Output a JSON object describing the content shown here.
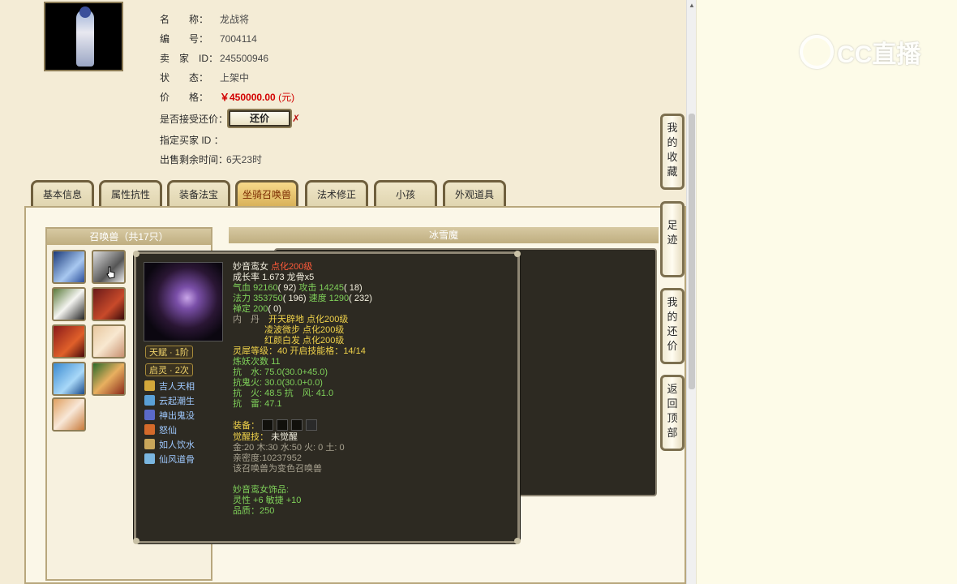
{
  "item": {
    "name_label": "名　　称：",
    "name": "龙战将",
    "id_label": "编　　号：",
    "id": "7004114",
    "seller_label": "卖　家　ID：",
    "seller_id": "245500946",
    "status_label": "状　　态：",
    "status": "上架中",
    "price_label": "价　　格：",
    "price": "￥450000.00",
    "price_unit": "(元)",
    "counter_label": "是否接受还价：",
    "counter_button": "还价",
    "counter_x": "✗",
    "buyer_label": "指定买家 ID ：",
    "buyer_id": "",
    "remaining_label": "出售剩余时间：",
    "remaining": "6天23时"
  },
  "tabs": [
    {
      "label": "基本信息"
    },
    {
      "label": "属性抗性"
    },
    {
      "label": "装备法宝"
    },
    {
      "label": "坐骑召唤兽",
      "active": true
    },
    {
      "label": "法术修正"
    },
    {
      "label": "小孩"
    },
    {
      "label": "外观道具"
    }
  ],
  "pet_list": {
    "header": "召唤兽（共17只）",
    "count_visible": 9
  },
  "detail_header": "冰雪魔",
  "float_menu": [
    {
      "label": "我的收藏"
    },
    {
      "label": "足迹"
    },
    {
      "label": "我的还价"
    },
    {
      "label": "返回顶部"
    }
  ],
  "popup": {
    "name": "妙音鸾女",
    "level": "点化200级",
    "growth_label": "成长率",
    "growth": "1.673",
    "bone": "龙骨x5",
    "hp_label": "气血",
    "hp": "92160",
    "hp_rank": "( 92)",
    "atk_label": "攻击",
    "atk": "14245",
    "atk_rank": "( 18)",
    "mp_label": "法力",
    "mp": "353750",
    "mp_rank": "( 196)",
    "spd_label": "速度",
    "spd": "1290",
    "spd_rank": "( 232)",
    "zen_label": "禅定",
    "zen": "200",
    "zen_rank": "( 0)",
    "core_label": "内　丹",
    "cores": [
      "开天辟地 点化200级",
      "凌波微步 点化200级",
      "红颜白发 点化200级"
    ],
    "spirit_label": "灵犀等级：",
    "spirit": "40",
    "spirit_slots_label": "开启技能格：",
    "spirit_slots": "14/14",
    "refine_label": "炼妖次数",
    "refine": "11",
    "res_water": "抗　水: 75.0(30.0+45.0)",
    "res_ghost": "抗鬼火: 30.0(30.0+0.0)",
    "res_fire_wind": "抗　火: 48.5 抗　风: 41.0",
    "res_thunder": "抗　雷: 47.1",
    "equip_label": "装备：",
    "awaken_label": "觉醒技：",
    "awaken": "未觉醒",
    "elements": "金:20 木:30 水:50 火: 0 土: 0",
    "intimacy": "亲密度:10237952",
    "variant": "该召唤兽为变色召唤兽",
    "accessory_title": "妙音鸾女饰品:",
    "accessory_stats": "灵性 +6 敏捷 +10",
    "quality": "品质：250",
    "badges": [
      "天赋 · 1阶",
      "启灵 · 2次"
    ],
    "skills": [
      {
        "name": "吉人天相",
        "color": "#d4a83a"
      },
      {
        "name": "云起潮生",
        "color": "#5aa0d6"
      },
      {
        "name": "神出鬼没",
        "color": "#5b6ac9"
      },
      {
        "name": "怒仙",
        "color": "#d46a2a"
      },
      {
        "name": "如人饮水",
        "color": "#c9a65a"
      },
      {
        "name": "仙风道骨",
        "color": "#7ab6e0"
      }
    ]
  },
  "watermark": "CC直播",
  "colors": {
    "price_red": "#d20000",
    "popup_bg": "#2d2a22",
    "stat_green": "#7fd15a",
    "accent_gold": "#f0d24a"
  }
}
